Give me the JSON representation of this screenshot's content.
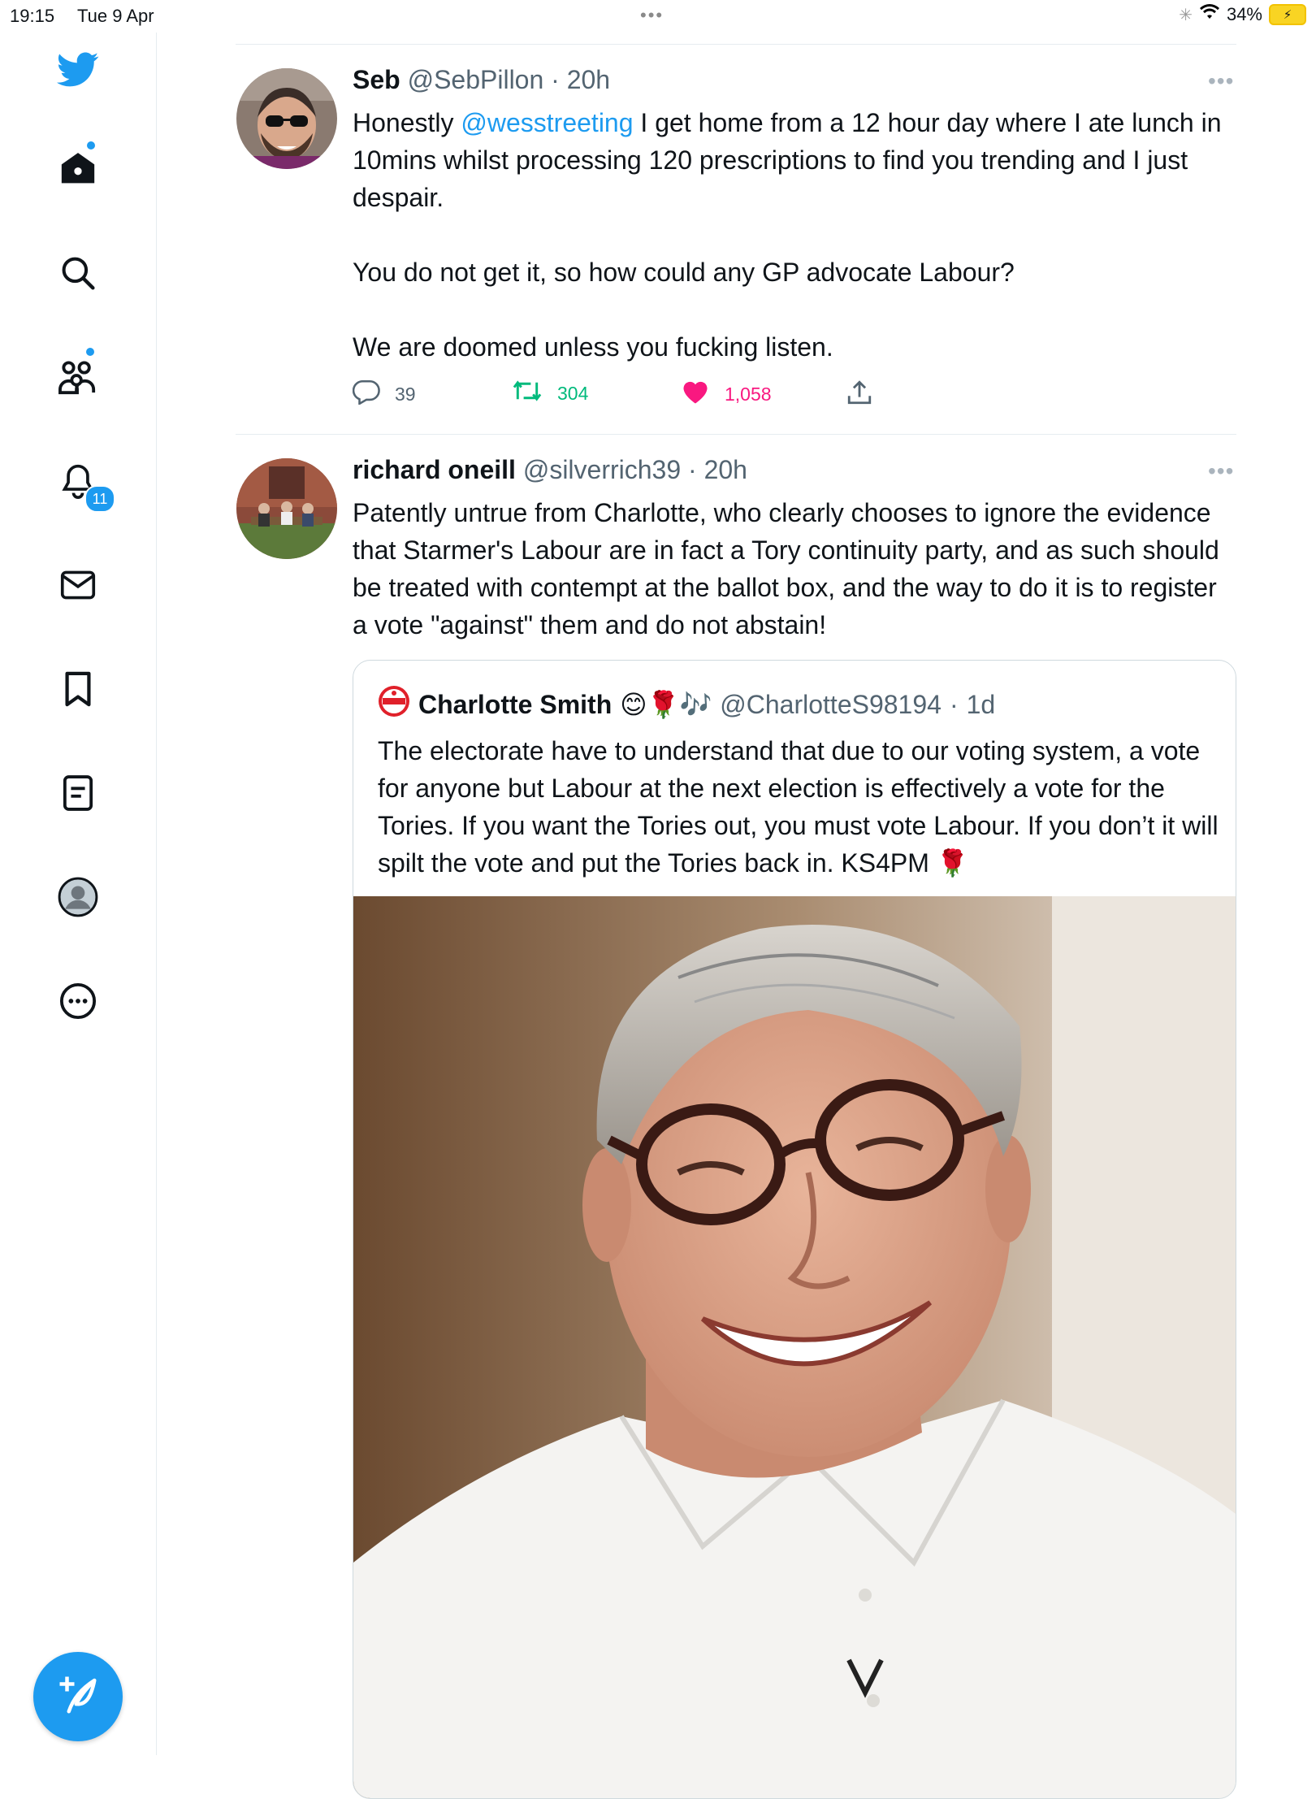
{
  "status_bar": {
    "time": "19:15",
    "date": "Tue 9 Apr",
    "dots": "•••",
    "battery": "34%"
  },
  "sidebar": {
    "notifications_badge": "11",
    "items": [
      {
        "name": "home",
        "icon": "home-icon",
        "has_dot": true
      },
      {
        "name": "explore",
        "icon": "search-icon",
        "has_dot": false
      },
      {
        "name": "communities",
        "icon": "people-icon",
        "has_dot": true
      },
      {
        "name": "notifications",
        "icon": "bell-icon",
        "has_dot": false
      },
      {
        "name": "messages",
        "icon": "envelope-icon",
        "has_dot": false
      },
      {
        "name": "bookmarks",
        "icon": "bookmark-icon",
        "has_dot": false
      },
      {
        "name": "lists",
        "icon": "list-icon",
        "has_dot": false
      },
      {
        "name": "profile",
        "icon": "avatar-icon",
        "has_dot": false
      },
      {
        "name": "more",
        "icon": "more-circle-icon",
        "has_dot": false
      }
    ],
    "compose_icon": "compose-icon"
  },
  "tweets": [
    {
      "name": "Seb",
      "handle": "@SebPillon",
      "separator": "·",
      "time": "20h",
      "more": "•••",
      "text_before": "Honestly ",
      "mention": "@wesstreeting",
      "text_after": " I get home from a 12 hour day where I ate lunch in 10mins whilst processing 120 prescriptions to find you trending and I just despair.\n\nYou do not get it, so how could any GP advocate Labour?\n\nWe are doomed unless you fucking listen.",
      "replies": "39",
      "retweets": "304",
      "likes": "1,058"
    },
    {
      "name": "richard oneill",
      "handle": "@silverrich39",
      "separator": "·",
      "time": "20h",
      "more": "•••",
      "text": "Patently untrue from Charlotte, who clearly chooses to ignore the evidence that Starmer's Labour are in fact a Tory continuity party, and as such should be treated with contempt at the ballot box, and the way to do it is to register a vote \"against\" them and do not abstain!",
      "quote": {
        "name": "Charlotte Smith",
        "emojis": "😊🌹🎶",
        "handle": "@CharlotteS98194",
        "separator": "·",
        "time": "1d",
        "text": "The electorate have to understand that due to our voting system, a vote for anyone but Labour at the next election is effectively a vote for the Tories. If you want the Tories out, you must vote Labour. If you don’t it will spilt the vote and put the Tories back in. KS4PM 🌹"
      }
    }
  ],
  "colors": {
    "accent": "#1d9bf0",
    "retweet": "#00ba7c",
    "like": "#f91880",
    "muted": "#536471",
    "border": "#e6ecf0"
  }
}
